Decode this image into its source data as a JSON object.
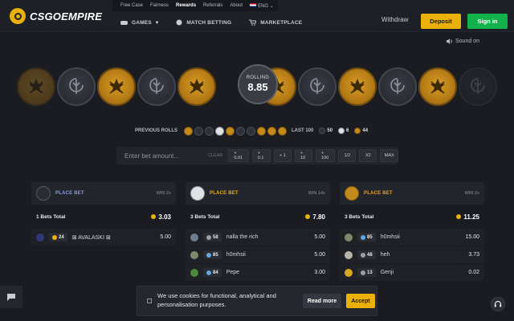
{
  "brand": {
    "name": "CSGOEMPIRE"
  },
  "topnav": {
    "items": [
      "Free Case",
      "Fairness",
      "Rewards",
      "Referrals",
      "About"
    ],
    "language": "ENG"
  },
  "mainnav": {
    "games": "GAMES",
    "match_betting": "MATCH BETTING",
    "marketplace": "MARKETPLACE"
  },
  "account": {
    "withdraw": "Withdraw",
    "deposit": "Deposit",
    "signin": "Sign in"
  },
  "sound": {
    "label": "Sound on"
  },
  "roller": {
    "label": "ROLLING",
    "value": "8.85",
    "coins": [
      "t",
      "ct",
      "t",
      "ct",
      "t",
      "ct",
      "t",
      "ct",
      "t",
      "ct",
      "t",
      "ct"
    ]
  },
  "previous_rolls": {
    "label": "PREVIOUS ROLLS",
    "rolls": [
      "t",
      "ct",
      "ct",
      "dice",
      "t",
      "ct",
      "ct",
      "t",
      "t",
      "t"
    ],
    "last100_label": "LAST 100",
    "counts": {
      "ct": "50",
      "dice": "6",
      "t": "44"
    }
  },
  "bet_input": {
    "placeholder": "Enter bet amount...",
    "clear": "CLEAR",
    "chips": [
      "+ 0.01",
      "+ 0.1",
      "+ 1",
      "+ 10",
      "+ 100",
      "1/2",
      "X2",
      "MAX"
    ]
  },
  "columns": [
    {
      "type": "ct",
      "label": "PLACE BET",
      "label_color": "#8a9bd6",
      "win": "WIN 2x",
      "total_label": "1 Bets Total",
      "total": "3.03",
      "bets": [
        {
          "level": "24",
          "level_color": "#e9b10a",
          "name": "⊠ AVALASKI ⊠",
          "amount": "5.00",
          "avatar": "#2d3a7a"
        }
      ]
    },
    {
      "type": "dice",
      "label": "PLACE BET",
      "label_color": "#e9b10a",
      "win": "WIN 14x",
      "total_label": "3 Bets Total",
      "total": "7.80",
      "bets": [
        {
          "level": "58",
          "level_color": "#9aa0aa",
          "name": "nalla the rich",
          "amount": "5.00",
          "avatar": "#6a7e8f"
        },
        {
          "level": "85",
          "level_color": "#5fa8e0",
          "name": "h0mhsii",
          "amount": "5.00",
          "avatar": "#7c8a6a"
        },
        {
          "level": "84",
          "level_color": "#5fa8e0",
          "name": "Pepe",
          "amount": "3.00",
          "avatar": "#4a8a3a"
        }
      ]
    },
    {
      "type": "t",
      "label": "PLACE BET",
      "label_color": "#e9a020",
      "win": "WIN 2x",
      "total_label": "3 Bets Total",
      "total": "11.25",
      "bets": [
        {
          "level": "85",
          "level_color": "#5fa8e0",
          "name": "h0mhsii",
          "amount": "15.00",
          "avatar": "#7c8a6a"
        },
        {
          "level": "48",
          "level_color": "#9aa0aa",
          "name": "heh",
          "amount": "3.73",
          "avatar": "#b8b4a8"
        },
        {
          "level": "13",
          "level_color": "#9aa0aa",
          "name": "Genji",
          "amount": "0.02",
          "avatar": "#d8a820"
        }
      ]
    }
  ],
  "cookie": {
    "message": "We use cookies for functional, analytical and personalisation purposes.",
    "read_more": "Read more",
    "accept": "Accept"
  }
}
